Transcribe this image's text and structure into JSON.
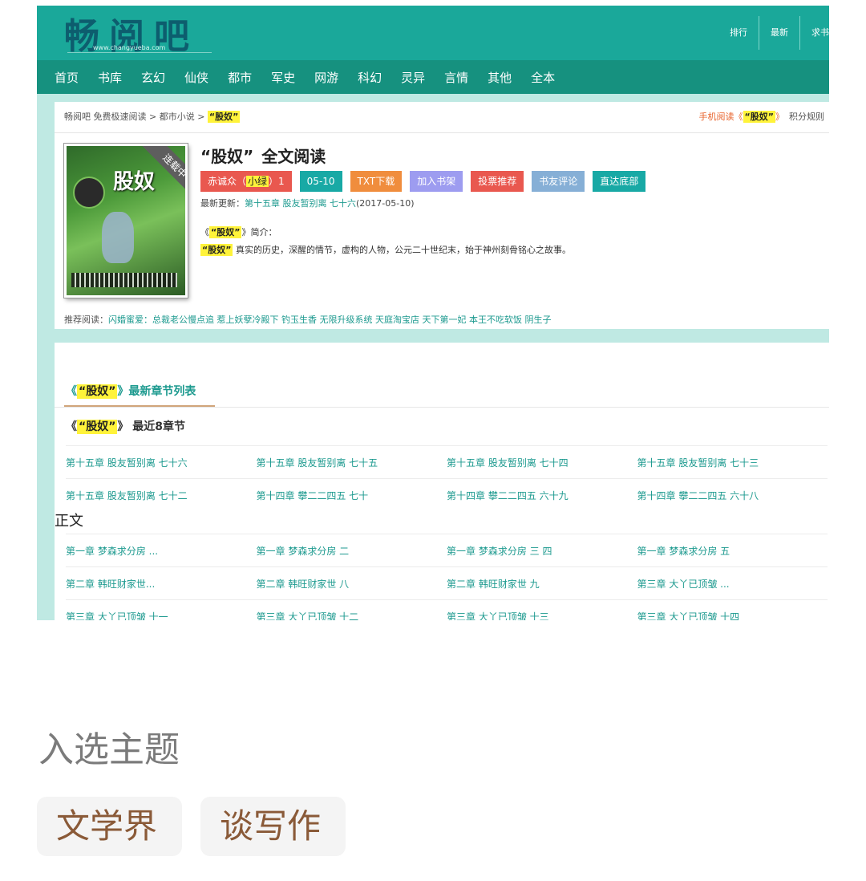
{
  "site": {
    "logo_text": "畅阅吧",
    "logo_url": "www.changyueba.com",
    "top_links": [
      "排行",
      "最新",
      "求书"
    ],
    "nav": [
      "首页",
      "书库",
      "玄幻",
      "仙侠",
      "都市",
      "军史",
      "网游",
      "科幻",
      "灵异",
      "言情",
      "其他",
      "全本"
    ]
  },
  "breadcrumb": {
    "prefix": "畅阅吧 免费极速阅读 > 都市小说 > ",
    "book": "“股奴”",
    "mobile_prefix": "手机阅读《",
    "mobile_suffix": "》",
    "rules": "积分规则"
  },
  "book": {
    "title": "“股奴”",
    "title_suffix": "全文阅读",
    "status_ribbon": "连载中",
    "cover_title": "股奴",
    "author_label": "赤诚众（",
    "author_highlight": "小绿",
    "author_suffix": "）1",
    "update_date": "05-10",
    "buttons": {
      "txt": "TXT下载",
      "shelf": "加入书架",
      "vote": "投票推荐",
      "review": "书友评论",
      "bottom": "直达底部"
    },
    "latest_label": "最新更新：",
    "latest_chapter": "第十五章 股友暂别离 七十六",
    "latest_date": "(2017-05-10)",
    "intro_prefix": "《",
    "intro_suffix": "》简介：",
    "intro_text": " 真实的历史，深醒的情节，虚构的人物，公元二十世纪末，始于神州刻骨铭心之故事。"
  },
  "recommend": {
    "label": "推荐阅读：",
    "links": "闪婚蜜爱：总裁老公慢点追 惹上妖孽冷殿下 钓玉生香 无限升级系统 天庭淘宝店 天下第一妃 本王不吃软饭 阴生子"
  },
  "chapters": {
    "list_heading_prefix": "《",
    "list_heading_suffix": "》最新章节列表",
    "recent_prefix": "《",
    "recent_suffix": "》 最近8章节",
    "recent": [
      [
        "第十五章 股友暂别离 七十六",
        "第十五章 股友暂别离 七十五",
        "第十五章 股友暂别离 七十四",
        "第十五章 股友暂别离 七十三"
      ],
      [
        "第十五章 股友暂别离 七十二",
        "第十四章 攀二二四五 七十",
        "第十四章 攀二二四五 六十九",
        "第十四章 攀二二四五 六十八"
      ]
    ],
    "main_label": "正文",
    "main": [
      [
        "第一章 梦森求分房 ...",
        "第一章 梦森求分房 二",
        "第一章 梦森求分房 三 四",
        "第一章 梦森求分房 五"
      ],
      [
        "第二章 韩旺财家世...",
        "第二章 韩旺财家世 八",
        "第二章 韩旺财家世 九",
        "第三章 大丫已顶皱 ..."
      ],
      [
        "第三章 大丫已顶皱 十一",
        "第三章 大丫已顶皱 十二",
        "第三章 大丫已顶皱 十三",
        "第三章 大丫已顶皱 十四"
      ]
    ]
  },
  "article": {
    "topic_heading": "入选主题",
    "tags": [
      "文学界",
      "谈写作"
    ]
  }
}
